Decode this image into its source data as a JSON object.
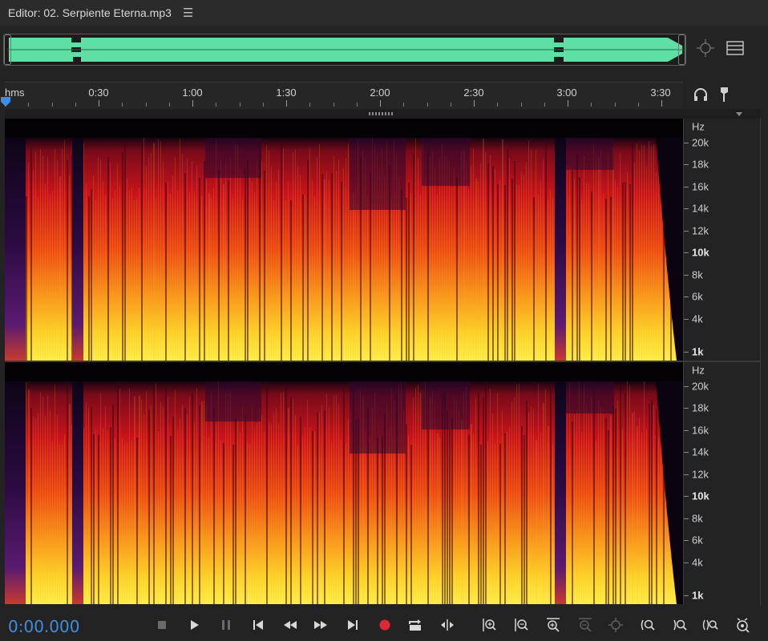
{
  "window": {
    "title": "Editor: 02. Serpiente Eterna.mp3",
    "menu_icon": "hamburger-icon"
  },
  "colors": {
    "waveform": "#5ee0a4",
    "timecode": "#3d8ee0",
    "playhead": "#3d8ee0",
    "record": "#e0283a",
    "background": "#232323"
  },
  "ruler": {
    "format_label": "hms",
    "labels": [
      "0:30",
      "1:00",
      "1:30",
      "2:00",
      "2:30",
      "3:00",
      "3:30"
    ]
  },
  "frequency_axis": {
    "unit": "Hz",
    "labels": [
      "20k",
      "18k",
      "16k",
      "14k",
      "12k",
      "10k",
      "8k",
      "6k",
      "4k",
      "1k"
    ],
    "emphasized": [
      "10k",
      "1k"
    ]
  },
  "transport": {
    "timecode": "0:00.000",
    "buttons": [
      "stop-icon",
      "play-icon",
      "pause-icon",
      "skip-to-start-icon",
      "rewind-icon",
      "fast-forward-icon",
      "skip-to-end-icon",
      "record-icon",
      "loop-icon",
      "skip-selection-icon"
    ],
    "zoom_buttons": [
      "zoom-in-amplitude-icon",
      "zoom-out-amplitude-icon",
      "zoom-in-time-icon",
      "zoom-out-time-icon",
      "zoom-to-selection-icon",
      "zoom-in-left-icon",
      "zoom-in-right-icon",
      "zoom-selection-icon",
      "zoom-full-icon"
    ]
  }
}
